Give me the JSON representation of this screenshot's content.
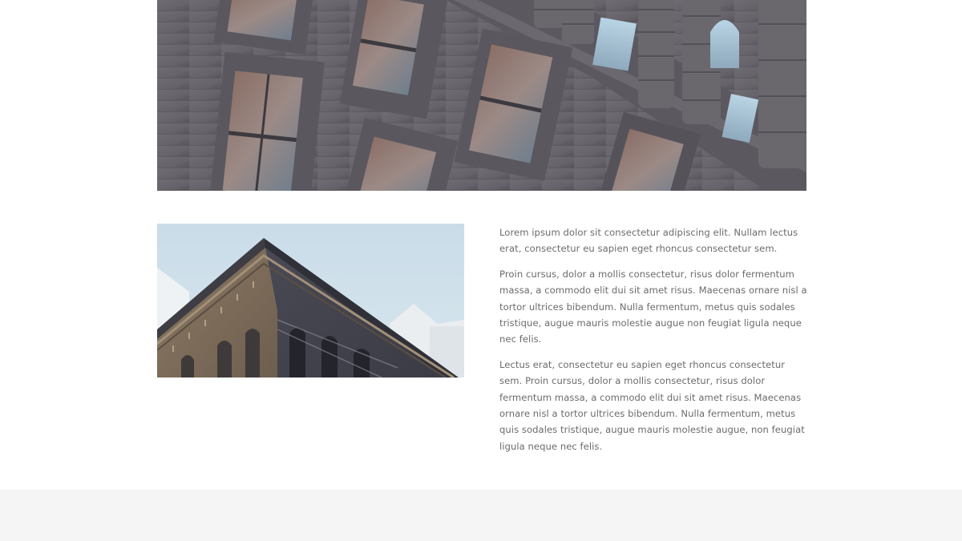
{
  "content": {
    "paragraphs": [
      "Lorem ipsum dolor sit consectetur adipiscing elit. Nullam lectus erat, consectetur eu sapien eget rhoncus consectetur sem.",
      "Proin cursus, dolor a mollis consectetur, risus dolor fermentum massa, a commodo elit dui sit amet risus. Maecenas ornare nisl a tortor ultrices bibendum. Nulla fermentum, metus quis sodales tristique, augue mauris molestie augue non feugiat ligula neque nec felis.",
      "Lectus erat, consectetur eu sapien eget rhoncus consectetur sem. Proin cursus, dolor a mollis consectetur, risus dolor fermentum massa, a commodo elit dui sit amet risus. Maecenas ornare nisl a tortor ultrices bibendum. Nulla fermentum, metus quis sodales tristique, augue mauris molestie augue, non feugiat ligula neque nec felis."
    ]
  },
  "colors": {
    "page_background": "#ffffff",
    "body_text": "#6c6c6c",
    "footer_band": "#f5f5f5",
    "facade_stone": "#6b6870",
    "sky": "#cfe0ea"
  }
}
